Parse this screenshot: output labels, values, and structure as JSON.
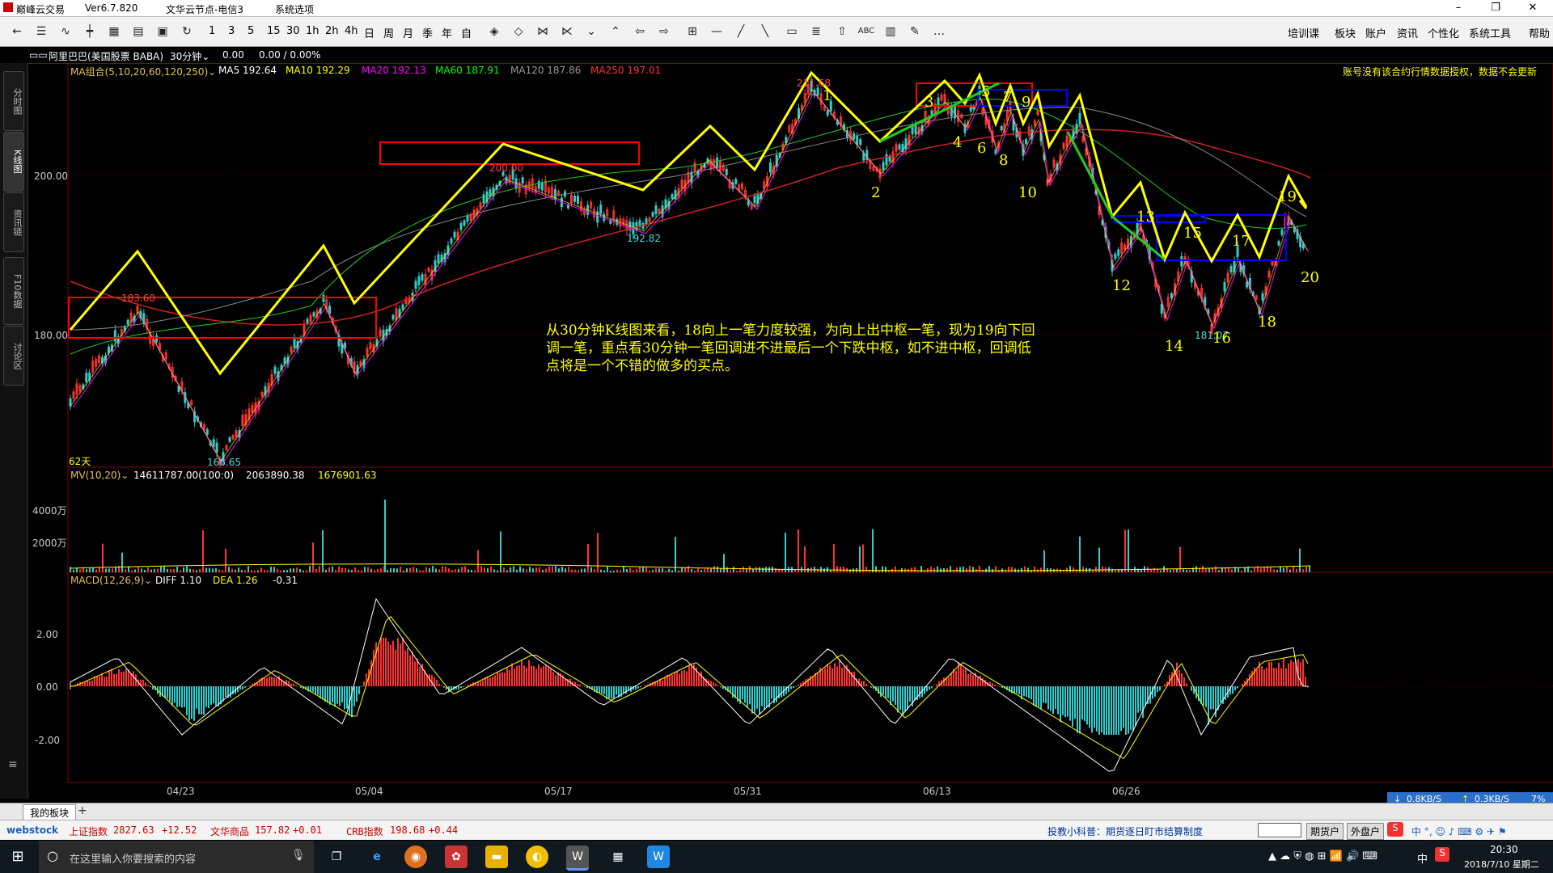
{
  "window": {
    "app_title": "巅峰云交易",
    "version": "Ver6.7.820",
    "server": "文华云节点-电信3",
    "menu_sys": "系统选项"
  },
  "toolbar": {
    "icons": [
      "back-icon",
      "list-icon",
      "chart-icon",
      "candle-icon",
      "calc-icon",
      "save-icon",
      "refresh-icon"
    ],
    "periods": [
      "1",
      "3",
      "5",
      "15",
      "30",
      "1h",
      "2h",
      "4h",
      "日",
      "周",
      "月",
      "季",
      "年",
      "自"
    ],
    "right_menu": [
      "培训课",
      "板块",
      "账户",
      "资讯",
      "个性化",
      "系统工具",
      "帮助"
    ]
  },
  "stock": {
    "name": "阿里巴巴(美国股票 BABA)",
    "period": "30分钟",
    "price": "0.00",
    "change": "0.00 / 0.00%"
  },
  "left_tabs": [
    "分时图",
    "K线图",
    "资讯链",
    "F10数据",
    "讨论区"
  ],
  "main_chart": {
    "ma_label": "MA组合(5,10,20,60,120,250)",
    "ma5": "MA5 192.64",
    "ma10": "MA10 192.29",
    "ma20": "MA20 192.13",
    "ma60": "MA60 187.91",
    "ma120": "MA120 187.86",
    "ma250": "MA250 197.01",
    "warning": "账号没有该合约行情数据授权，数据不会更新",
    "y_ticks": [
      "200.00",
      "180.00"
    ],
    "price_labels": [
      "211.68",
      "200.00",
      "192.82",
      "183.60",
      "166.65",
      "181.07"
    ],
    "days_label": "62天",
    "wave_numbers": [
      "1",
      "2",
      "3",
      "4",
      "5",
      "6",
      "7",
      "8",
      "9",
      "10",
      "12",
      "13",
      "14",
      "15",
      "16",
      "17",
      "18",
      "19",
      "20"
    ],
    "note": "从30分钟K线图来看，18向上一笔力度较强，为向上出中枢一笔，现为19向下回调一笔，重点看30分钟一笔回调进不进最后一个下跌中枢，如不进中枢，回调低点将是一个不错的做多的买点。"
  },
  "volume_chart": {
    "label": "MV(10,20)",
    "v1": "14611787.00(100:0)",
    "v2": "2063890.38",
    "v3": "1676901.63",
    "y_ticks": [
      "4000万",
      "2000万"
    ]
  },
  "macd_chart": {
    "label": "MACD(12,26,9)",
    "diff": "DIFF 1.10",
    "dea": "DEA 1.26",
    "macd": "-0.31",
    "y_ticks": [
      "2.00",
      "0.00",
      "-2.00"
    ]
  },
  "x_ticks": [
    "04/23",
    "05/04",
    "05/17",
    "05/31",
    "06/13",
    "06/26"
  ],
  "bottom_tab": {
    "label": "我的板块",
    "add": "+"
  },
  "ticker": {
    "logo": "webstock",
    "items": [
      {
        "name": "上证指数",
        "value": "2827.63",
        "change": "+12.52"
      },
      {
        "name": "文华商品",
        "value": "157.82",
        "change": "+0.01"
      },
      {
        "name": "CRB指数",
        "value": "198.68",
        "change": "+0.44"
      }
    ],
    "news": "投教小科普：期货逐日盯市结算制度",
    "btn1": "期货户",
    "btn2": "外盘户"
  },
  "netspeed": {
    "down": "0.8KB/S",
    "up": "0.3KB/S",
    "pct": "7%"
  },
  "taskbar": {
    "search_placeholder": "在这里输入你要搜索的内容",
    "time": "20:30",
    "date": "2018/7/10 星期二",
    "ime": "中"
  }
}
